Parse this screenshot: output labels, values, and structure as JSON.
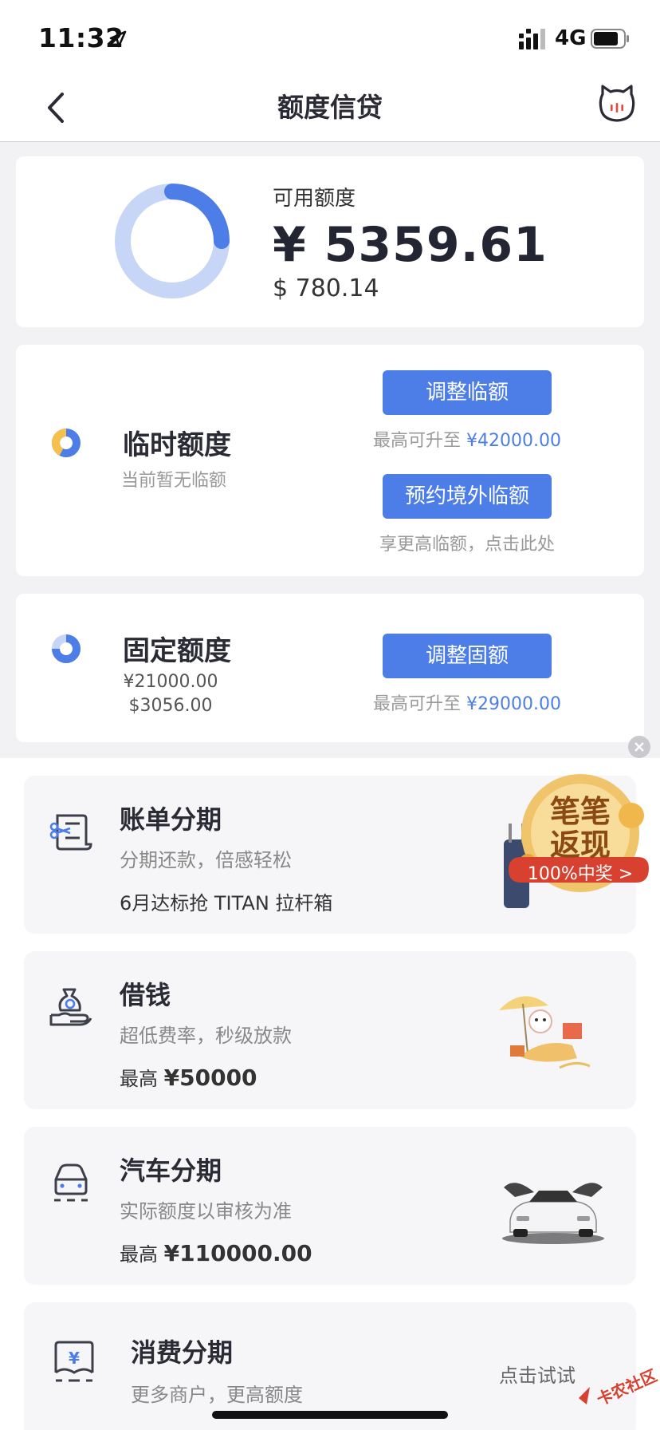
{
  "status": {
    "time": "11:32",
    "network": "4G"
  },
  "nav": {
    "title": "额度信贷"
  },
  "available": {
    "label": "可用额度",
    "amount_cny": "¥ 5359.61",
    "amount_usd": "$ 780.14",
    "used_fraction": 0.25
  },
  "temp_quota": {
    "title": "临时额度",
    "subtitle": "当前暂无临额",
    "adjust_button": "调整临额",
    "adjust_hint_prefix": "最高可升至 ",
    "adjust_hint_amount": "¥42000.00",
    "overseas_button": "预约境外临额",
    "overseas_hint": "享更高临额，点击此处"
  },
  "fixed_quota": {
    "title": "固定额度",
    "value_cny": "¥21000.00",
    "value_usd": "$3056.00",
    "adjust_button": "调整固额",
    "adjust_hint_prefix": "最高可升至 ",
    "adjust_hint_amount": "¥29000.00"
  },
  "products": [
    {
      "title": "账单分期",
      "subtitle": "分期还款，倍感轻松",
      "extra": "6月达标抢 TITAN 拉杆箱"
    },
    {
      "title": "借钱",
      "subtitle": "超低费率，秒级放款",
      "extra_prefix": "最高 ",
      "extra_amount": "¥50000"
    },
    {
      "title": "汽车分期",
      "subtitle": "实际额度以审核为准",
      "extra_prefix": "最高 ",
      "extra_amount": "¥110000.00"
    },
    {
      "title": "消费分期",
      "subtitle": "更多商户，更高额度",
      "action": "点击试试"
    }
  ],
  "promo_badge": {
    "line1": "笔笔",
    "line2": "返现",
    "ribbon": "100%中奖 >"
  },
  "watermark": "卡农社区",
  "colors": {
    "accent": "#4d7ee8",
    "donut_light": "#c7d6f7",
    "ribbon_red": "#d8412f",
    "badge_gold": "#f0c46b"
  }
}
